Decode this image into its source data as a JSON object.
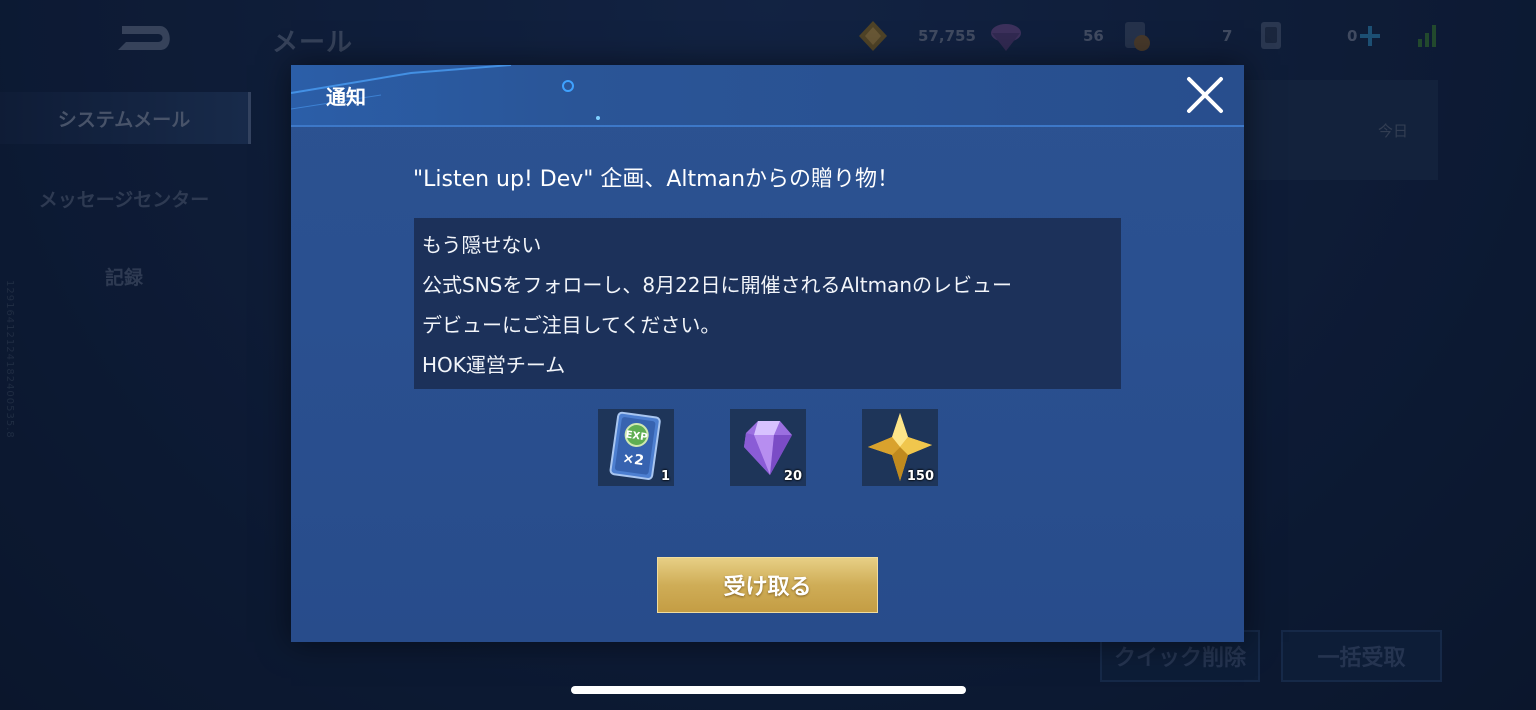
{
  "header": {
    "title": "メール",
    "resources": [
      {
        "icon": "gold-crystal-icon",
        "value": "57,755"
      },
      {
        "icon": "purple-gem-icon",
        "value": "56"
      },
      {
        "icon": "ticket-card-icon",
        "value": "7"
      },
      {
        "icon": "card-icon",
        "value": "0"
      }
    ]
  },
  "sidebar": {
    "items": [
      {
        "label": "システムメール",
        "active": true
      },
      {
        "label": "メッセージセンター",
        "active": false
      },
      {
        "label": "記録",
        "active": false
      }
    ],
    "side_id": "12916412124182400535.8"
  },
  "mail_list": {
    "date": "今日"
  },
  "footer_buttons": {
    "quick_delete": "クイック削除",
    "claim_all": "一括受取"
  },
  "modal": {
    "title": "通知",
    "subject": "\"Listen up! Dev\" 企画、Altmanからの贈り物！",
    "body_lines": [
      "もう隠せない",
      "公式SNSをフォローし、8月22日に開催されるAltmanのレビュー",
      "デビューにご注目してください。",
      "HOK運営チーム"
    ],
    "rewards": [
      {
        "icon": "exp-card-x2-icon",
        "count": "1"
      },
      {
        "icon": "purple-diamond-icon",
        "count": "20"
      },
      {
        "icon": "gold-star-crystal-icon",
        "count": "150"
      }
    ],
    "claim_label": "受け取る"
  },
  "colors": {
    "accent_gold": "#cfad57",
    "modal_blue": "#2a5090",
    "body_box": "#1c315a"
  }
}
